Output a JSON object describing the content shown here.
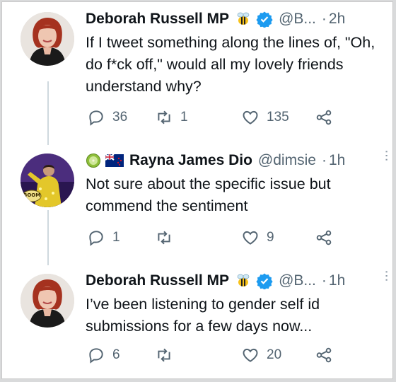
{
  "tweets": [
    {
      "name": "Deborah Russell MP",
      "handle": "@B...",
      "time": "2h",
      "text": "If I tweet something along the lines of, \"Oh, do f*ck off,\" would all my lovely friends understand why?",
      "replies": "36",
      "retweets": "1",
      "likes": "135"
    },
    {
      "name": "Rayna James Dio",
      "handle": "@dimsie",
      "time": "1h",
      "text": "Not sure about the specific issue but commend the sentiment",
      "avatar_badge": "BOOM",
      "replies": "1",
      "retweets": "",
      "likes": "9"
    },
    {
      "name": "Deborah Russell MP",
      "handle": "@B...",
      "time": "1h",
      "text": "I’ve been listening to gender self id submissions for a few days now...",
      "replies": "6",
      "retweets": "",
      "likes": "20"
    }
  ],
  "colors": {
    "text": "#0f1419",
    "muted": "#536471",
    "verified": "#1d9bf0",
    "thread_line": "#cfd9de"
  },
  "icons": [
    "reply-icon",
    "retweet-icon",
    "like-icon",
    "share-icon",
    "verified-icon",
    "bee-emoji-icon",
    "more-icon",
    "kiwi-emoji-icon",
    "nz-flag-icon"
  ]
}
